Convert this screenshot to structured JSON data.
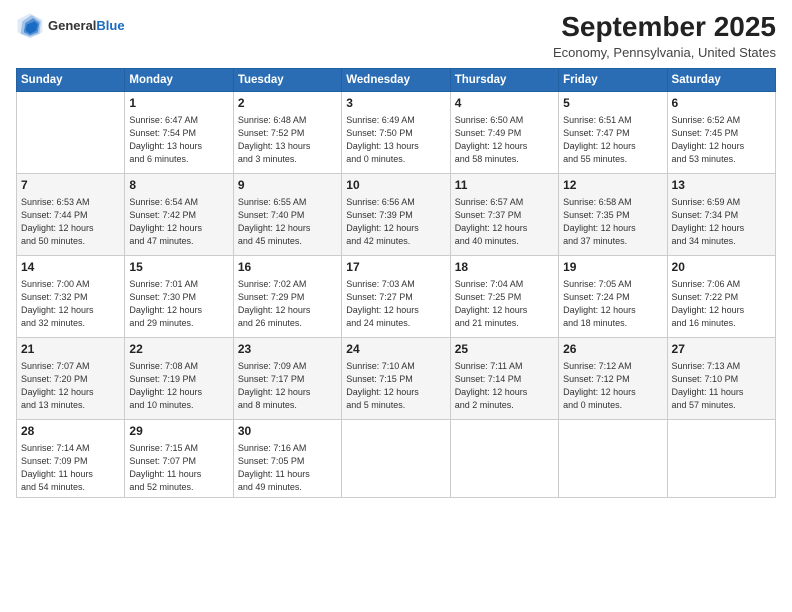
{
  "logo": {
    "general": "General",
    "blue": "Blue"
  },
  "header": {
    "month_title": "September 2025",
    "subtitle": "Economy, Pennsylvania, United States"
  },
  "days_of_week": [
    "Sunday",
    "Monday",
    "Tuesday",
    "Wednesday",
    "Thursday",
    "Friday",
    "Saturday"
  ],
  "weeks": [
    [
      {
        "day": "",
        "info": ""
      },
      {
        "day": "1",
        "info": "Sunrise: 6:47 AM\nSunset: 7:54 PM\nDaylight: 13 hours\nand 6 minutes."
      },
      {
        "day": "2",
        "info": "Sunrise: 6:48 AM\nSunset: 7:52 PM\nDaylight: 13 hours\nand 3 minutes."
      },
      {
        "day": "3",
        "info": "Sunrise: 6:49 AM\nSunset: 7:50 PM\nDaylight: 13 hours\nand 0 minutes."
      },
      {
        "day": "4",
        "info": "Sunrise: 6:50 AM\nSunset: 7:49 PM\nDaylight: 12 hours\nand 58 minutes."
      },
      {
        "day": "5",
        "info": "Sunrise: 6:51 AM\nSunset: 7:47 PM\nDaylight: 12 hours\nand 55 minutes."
      },
      {
        "day": "6",
        "info": "Sunrise: 6:52 AM\nSunset: 7:45 PM\nDaylight: 12 hours\nand 53 minutes."
      }
    ],
    [
      {
        "day": "7",
        "info": "Sunrise: 6:53 AM\nSunset: 7:44 PM\nDaylight: 12 hours\nand 50 minutes."
      },
      {
        "day": "8",
        "info": "Sunrise: 6:54 AM\nSunset: 7:42 PM\nDaylight: 12 hours\nand 47 minutes."
      },
      {
        "day": "9",
        "info": "Sunrise: 6:55 AM\nSunset: 7:40 PM\nDaylight: 12 hours\nand 45 minutes."
      },
      {
        "day": "10",
        "info": "Sunrise: 6:56 AM\nSunset: 7:39 PM\nDaylight: 12 hours\nand 42 minutes."
      },
      {
        "day": "11",
        "info": "Sunrise: 6:57 AM\nSunset: 7:37 PM\nDaylight: 12 hours\nand 40 minutes."
      },
      {
        "day": "12",
        "info": "Sunrise: 6:58 AM\nSunset: 7:35 PM\nDaylight: 12 hours\nand 37 minutes."
      },
      {
        "day": "13",
        "info": "Sunrise: 6:59 AM\nSunset: 7:34 PM\nDaylight: 12 hours\nand 34 minutes."
      }
    ],
    [
      {
        "day": "14",
        "info": "Sunrise: 7:00 AM\nSunset: 7:32 PM\nDaylight: 12 hours\nand 32 minutes."
      },
      {
        "day": "15",
        "info": "Sunrise: 7:01 AM\nSunset: 7:30 PM\nDaylight: 12 hours\nand 29 minutes."
      },
      {
        "day": "16",
        "info": "Sunrise: 7:02 AM\nSunset: 7:29 PM\nDaylight: 12 hours\nand 26 minutes."
      },
      {
        "day": "17",
        "info": "Sunrise: 7:03 AM\nSunset: 7:27 PM\nDaylight: 12 hours\nand 24 minutes."
      },
      {
        "day": "18",
        "info": "Sunrise: 7:04 AM\nSunset: 7:25 PM\nDaylight: 12 hours\nand 21 minutes."
      },
      {
        "day": "19",
        "info": "Sunrise: 7:05 AM\nSunset: 7:24 PM\nDaylight: 12 hours\nand 18 minutes."
      },
      {
        "day": "20",
        "info": "Sunrise: 7:06 AM\nSunset: 7:22 PM\nDaylight: 12 hours\nand 16 minutes."
      }
    ],
    [
      {
        "day": "21",
        "info": "Sunrise: 7:07 AM\nSunset: 7:20 PM\nDaylight: 12 hours\nand 13 minutes."
      },
      {
        "day": "22",
        "info": "Sunrise: 7:08 AM\nSunset: 7:19 PM\nDaylight: 12 hours\nand 10 minutes."
      },
      {
        "day": "23",
        "info": "Sunrise: 7:09 AM\nSunset: 7:17 PM\nDaylight: 12 hours\nand 8 minutes."
      },
      {
        "day": "24",
        "info": "Sunrise: 7:10 AM\nSunset: 7:15 PM\nDaylight: 12 hours\nand 5 minutes."
      },
      {
        "day": "25",
        "info": "Sunrise: 7:11 AM\nSunset: 7:14 PM\nDaylight: 12 hours\nand 2 minutes."
      },
      {
        "day": "26",
        "info": "Sunrise: 7:12 AM\nSunset: 7:12 PM\nDaylight: 12 hours\nand 0 minutes."
      },
      {
        "day": "27",
        "info": "Sunrise: 7:13 AM\nSunset: 7:10 PM\nDaylight: 11 hours\nand 57 minutes."
      }
    ],
    [
      {
        "day": "28",
        "info": "Sunrise: 7:14 AM\nSunset: 7:09 PM\nDaylight: 11 hours\nand 54 minutes."
      },
      {
        "day": "29",
        "info": "Sunrise: 7:15 AM\nSunset: 7:07 PM\nDaylight: 11 hours\nand 52 minutes."
      },
      {
        "day": "30",
        "info": "Sunrise: 7:16 AM\nSunset: 7:05 PM\nDaylight: 11 hours\nand 49 minutes."
      },
      {
        "day": "",
        "info": ""
      },
      {
        "day": "",
        "info": ""
      },
      {
        "day": "",
        "info": ""
      },
      {
        "day": "",
        "info": ""
      }
    ]
  ]
}
